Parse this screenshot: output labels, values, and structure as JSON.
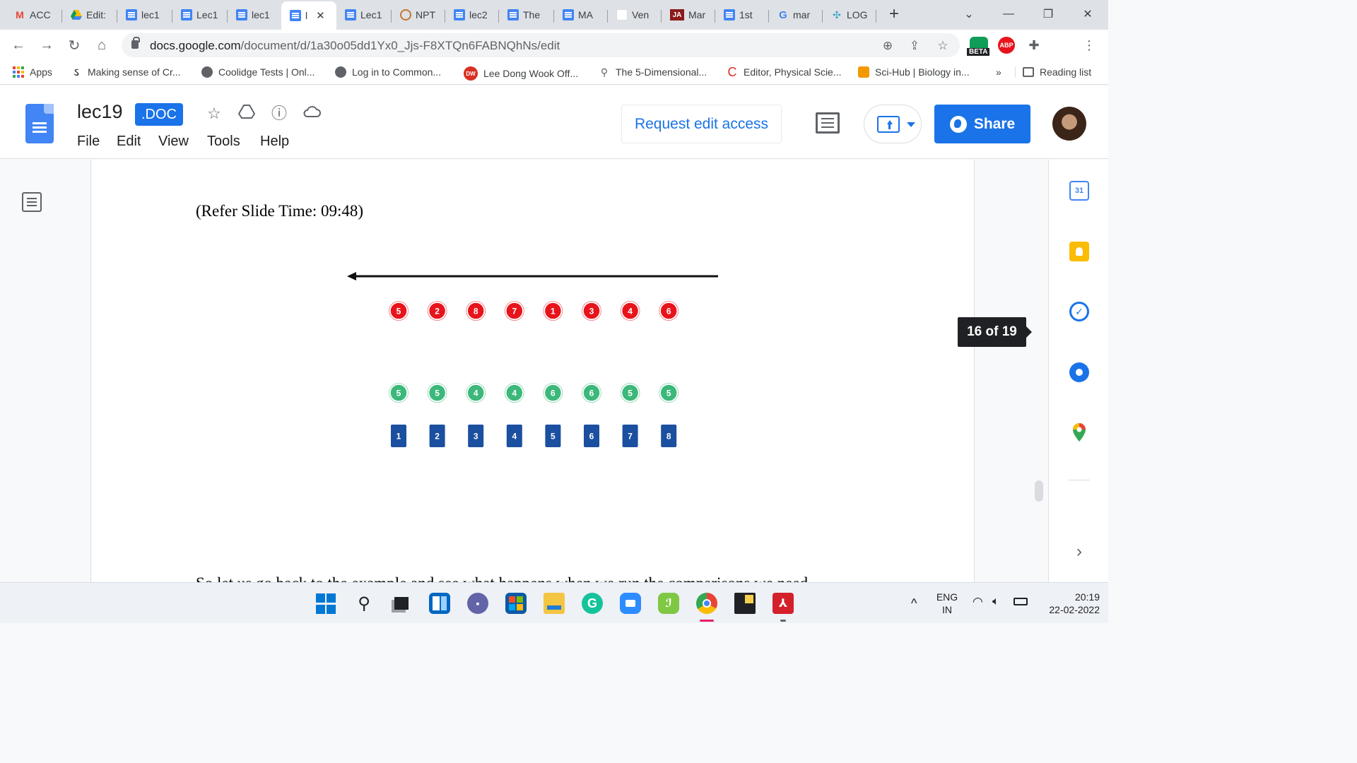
{
  "browser": {
    "tabs": [
      {
        "label": "ACC",
        "icon": "gmail-icon",
        "active": false
      },
      {
        "label": "Edit:",
        "icon": "drive-icon",
        "active": false
      },
      {
        "label": "lec1",
        "icon": "docs-icon",
        "active": false
      },
      {
        "label": "Lec1",
        "icon": "docs-icon",
        "active": false
      },
      {
        "label": "lec1",
        "icon": "docs-icon",
        "active": false
      },
      {
        "label": "l",
        "icon": "docs-icon",
        "active": true
      },
      {
        "label": "Lec1",
        "icon": "docs-icon",
        "active": false
      },
      {
        "label": "NPT",
        "icon": "nptel-icon",
        "active": false
      },
      {
        "label": "lec2",
        "icon": "docs-icon",
        "active": false
      },
      {
        "label": "The",
        "icon": "docs-icon",
        "active": false
      },
      {
        "label": "MA",
        "icon": "docs-icon",
        "active": false
      },
      {
        "label": "Ven",
        "icon": "blank-page-icon",
        "active": false
      },
      {
        "label": "Mar",
        "icon": "ja-icon",
        "active": false
      },
      {
        "label": "1st",
        "icon": "docs-icon",
        "active": false
      },
      {
        "label": "mar",
        "icon": "google-icon",
        "active": false
      },
      {
        "label": "LOG",
        "icon": "puzzle-site-icon",
        "active": false
      }
    ],
    "close_tab_glyph": "✕",
    "new_tab_glyph": "+",
    "url_host": "docs.google.com",
    "url_path": "/document/d/1a30o05dd1Yx0_Jjs-F8XTQn6FABNQhNs/edit",
    "beta_label": "BETA",
    "abp_label": "ABP",
    "bookmarks": [
      {
        "label": "Apps",
        "icon": "apps-grid-icon"
      },
      {
        "label": "Making sense of Cr...",
        "icon": "swirl-icon"
      },
      {
        "label": "Coolidge Tests | Onl...",
        "icon": "globe-icon"
      },
      {
        "label": "Log in to Common...",
        "icon": "globe-icon"
      },
      {
        "label": "Lee Dong Wook Off...",
        "icon": "dw-icon"
      },
      {
        "label": "The 5-Dimensional...",
        "icon": "lamp-icon"
      },
      {
        "label": "Editor, Physical Scie...",
        "icon": "c-logo-icon"
      },
      {
        "label": "Sci-Hub | Biology in...",
        "icon": "scihub-icon"
      }
    ],
    "more_bookmarks": "»",
    "reading_list": "Reading list"
  },
  "docs": {
    "title": "lec19",
    "badge": ".DOC",
    "menu": [
      "File",
      "Edit",
      "View",
      "Tools",
      "Help"
    ],
    "request_edit": "Request edit access",
    "share": "Share",
    "body": {
      "slide_time": "(Refer Slide Time: 09:48)",
      "next_line": "So let us go back to the example and see what happens when we run the comparisons we need"
    },
    "figure": {
      "red_row": [
        "5",
        "2",
        "8",
        "7",
        "1",
        "3",
        "4",
        "6"
      ],
      "green_row": [
        "5",
        "5",
        "4",
        "4",
        "6",
        "6",
        "5",
        "5"
      ],
      "blue_row": [
        "1",
        "2",
        "3",
        "4",
        "5",
        "6",
        "7",
        "8"
      ],
      "colors": {
        "red": "#e8141c",
        "green": "#3cb87a",
        "blue": "#1b4fa0"
      }
    },
    "page_indicator": "16 of 19"
  },
  "side_panel": {
    "calendar_day": "31",
    "icons": [
      "calendar-icon",
      "keep-icon",
      "tasks-icon",
      "contacts-icon",
      "maps-icon"
    ],
    "expand_glyph": "›"
  },
  "taskbar": {
    "apps": [
      "windows-start-icon",
      "search-icon",
      "task-view-icon",
      "widgets-icon",
      "teams-chat-icon",
      "store-icon",
      "file-explorer-icon",
      "grammarly-icon",
      "zoom-icon",
      "evernote-icon",
      "chrome-icon",
      "sticky-notes-icon",
      "acrobat-icon"
    ],
    "lang_line1": "ENG",
    "lang_line2": "IN",
    "time": "20:19",
    "date": "22-02-2022"
  }
}
